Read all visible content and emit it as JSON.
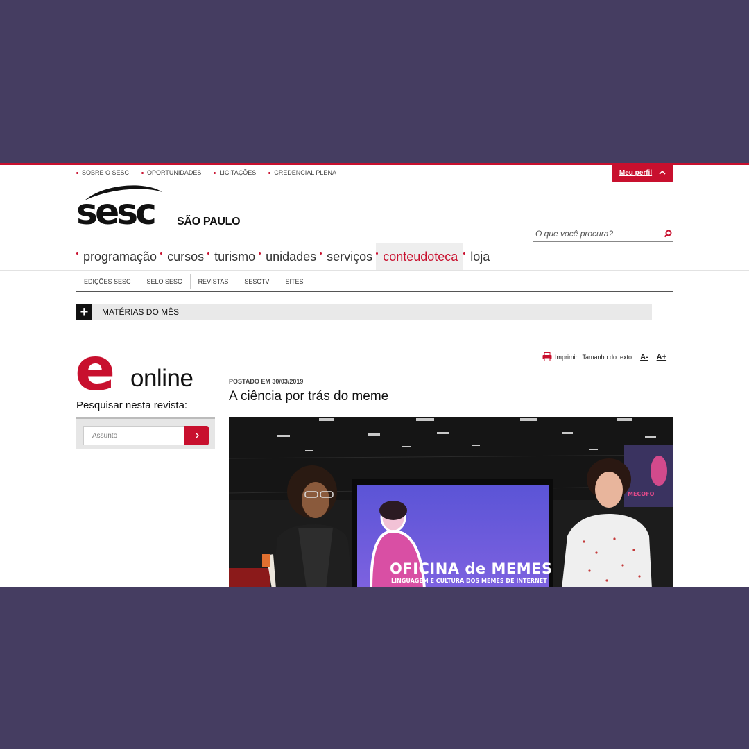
{
  "util_links": [
    "SOBRE O SESC",
    "OPORTUNIDADES",
    "LICITAÇÕES",
    "CREDENCIAL PLENA"
  ],
  "profile_label": "Meu perfil",
  "brand": {
    "logo_text": "sesc",
    "region": "SÃO PAULO"
  },
  "search": {
    "placeholder": "O que você procura?"
  },
  "main_nav": [
    "programação",
    "cursos",
    "turismo",
    "unidades",
    "serviços",
    "conteudoteca",
    "loja"
  ],
  "main_nav_active": "conteudoteca",
  "sub_nav": [
    "EDIÇÕES SESC",
    "SELO SESC",
    "REVISTAS",
    "SESCTV",
    "SITES"
  ],
  "materias_label": "MATÉRIAS DO MÊS",
  "magazine": {
    "logo_letter": "e",
    "logo_word": "online",
    "search_label": "Pesquisar nesta revista:",
    "search_placeholder": "Assunto"
  },
  "tools": {
    "print": "Imprimir",
    "text_size": "Tamanho do texto",
    "decrease": "A-",
    "increase": "A+"
  },
  "article": {
    "posted": "POSTADO EM 30/03/2019",
    "title": "A ciência por trás do meme"
  },
  "photo_screen": {
    "title": "OFICINA de MEMES",
    "subtitle": "LINGUAGEM E CULTURA DOS MEMES DE INTERNET",
    "banner_text": "MECOFO"
  },
  "colors": {
    "accent": "#c8102e",
    "frame": "#453d61"
  }
}
